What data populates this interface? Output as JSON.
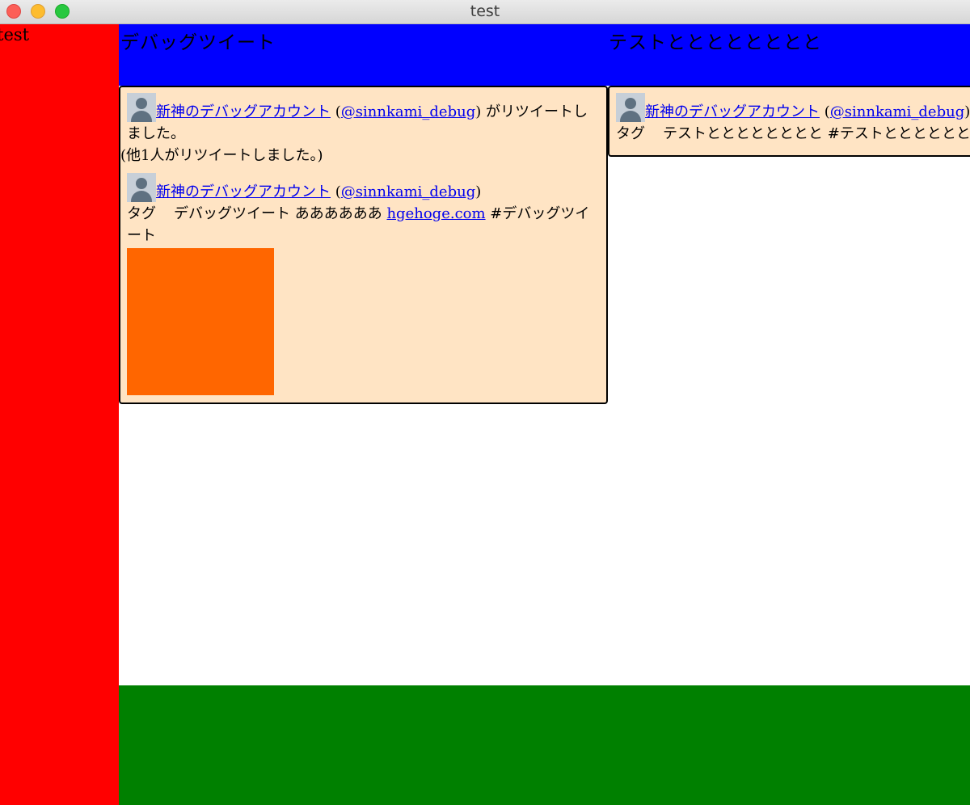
{
  "window": {
    "title": "test"
  },
  "sidebar": {
    "label": "test"
  },
  "columns": [
    {
      "title": "デバッグツイート"
    },
    {
      "title": "テストとととととととと"
    }
  ],
  "tweets": {
    "col1": {
      "retweet": {
        "user_name": "新神のデバッグアカウント",
        "screen_name": "@sinnkami_debug",
        "open_paren": "(",
        "close_paren": ")",
        "action_text": "がリツイートしました。",
        "others_text": "(他1人がリツイートしました。)"
      },
      "original": {
        "user_name": "新神のデバッグアカウント",
        "screen_name": "@sinnkami_debug",
        "open_paren": "(",
        "close_paren": ")",
        "tag_label": "タグ",
        "text": "デバッグツイート ああああああ",
        "link": "hgehoge.com",
        "hashtag": "#デバッグツイート",
        "media_color": "#ff6600"
      }
    },
    "col2": {
      "user_name": "新神のデバッグアカウント",
      "screen_name": "@sinnkami_debug",
      "open_paren": "(",
      "close_paren": ")",
      "tag_label": "タグ",
      "text": "テストとととととととと",
      "hashtag": "#テストとととととととと"
    }
  },
  "icons": {
    "avatar": "default-user-avatar-icon"
  },
  "colors": {
    "sidebar": "#ff0000",
    "header": "#0000ff",
    "footer": "#008000",
    "card": "#ffe4c4",
    "link": "#0000ee"
  }
}
